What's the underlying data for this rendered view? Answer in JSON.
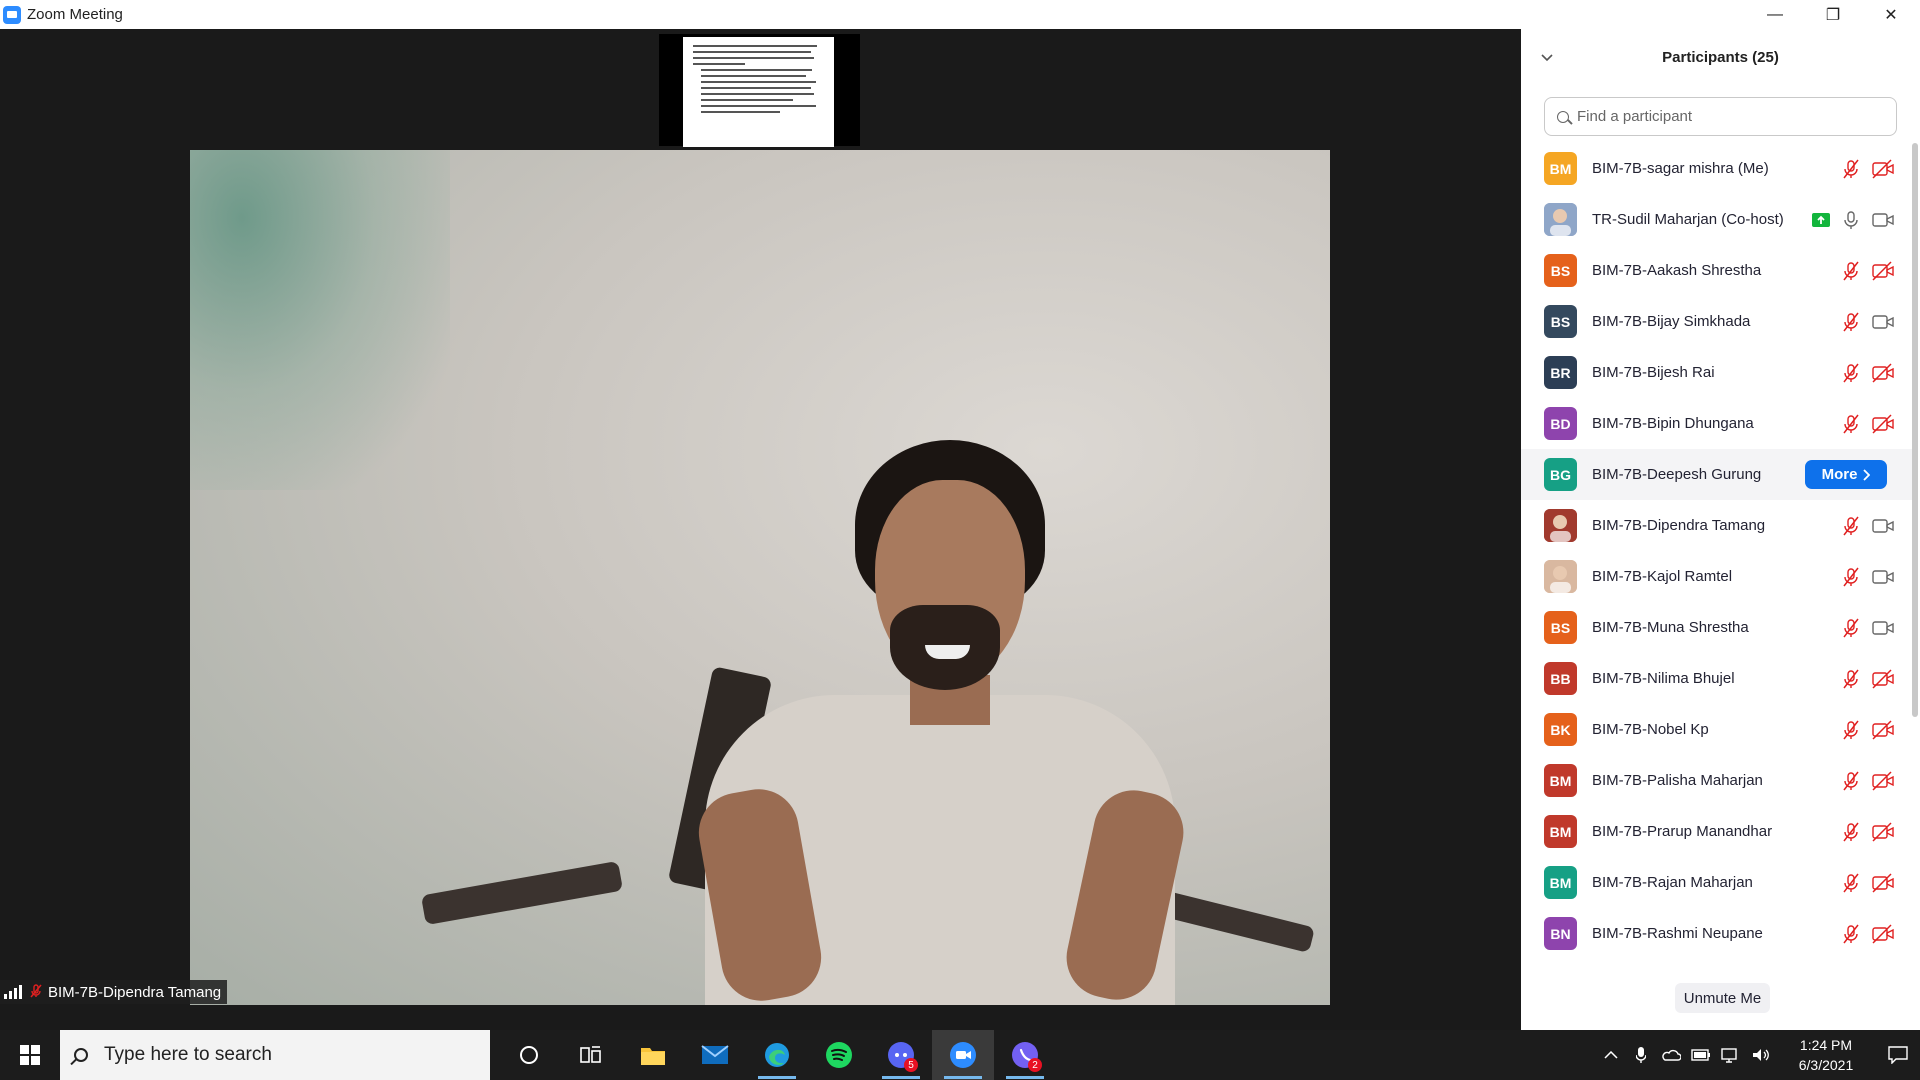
{
  "window": {
    "title": "Zoom Meeting",
    "controls": {
      "minimize": "—",
      "restore": "❐",
      "close": "✕"
    }
  },
  "meeting": {
    "speaker_name": "BIM-7B-Dipendra Tamang"
  },
  "participants_panel": {
    "title": "Participants (25)",
    "search_placeholder": "Find a participant",
    "more_label": "More",
    "unmute_label": "Unmute Me",
    "participants": [
      {
        "initials": "BM",
        "color": "#f5a623",
        "name": "BIM-7B-sagar mishra (Me)",
        "mic": "off",
        "video": "off"
      },
      {
        "initials": "",
        "color": "#8fa6c8",
        "name": "TR-Sudil Maharjan (Co-host)",
        "mic": "on",
        "video": "on",
        "sharing": true,
        "photo": true
      },
      {
        "initials": "BS",
        "color": "#e5611b",
        "name": "BIM-7B-Aakash Shrestha",
        "mic": "off",
        "video": "off"
      },
      {
        "initials": "BS",
        "color": "#34495e",
        "name": "BIM-7B-Bijay Simkhada",
        "mic": "off",
        "video": "on"
      },
      {
        "initials": "BR",
        "color": "#2c3e55",
        "name": "BIM-7B-Bijesh Rai",
        "mic": "off",
        "video": "off"
      },
      {
        "initials": "BD",
        "color": "#8e44ad",
        "name": "BIM-7B-Bipin Dhungana",
        "mic": "off",
        "video": "off"
      },
      {
        "initials": "BG",
        "color": "#16a085",
        "name": "BIM-7B-Deepesh Gurung",
        "hover": true
      },
      {
        "initials": "",
        "color": "#a13a2e",
        "name": "BIM-7B-Dipendra Tamang",
        "mic": "off",
        "video": "on",
        "photo": true
      },
      {
        "initials": "",
        "color": "#d9b8a0",
        "name": "BIM-7B-Kajol Ramtel",
        "mic": "off",
        "video": "on",
        "photo": true
      },
      {
        "initials": "BS",
        "color": "#e5611b",
        "name": "BIM-7B-Muna Shrestha",
        "mic": "off",
        "video": "on"
      },
      {
        "initials": "BB",
        "color": "#c0392b",
        "name": "BIM-7B-Nilima Bhujel",
        "mic": "off",
        "video": "off"
      },
      {
        "initials": "BK",
        "color": "#e5611b",
        "name": "BIM-7B-Nobel Kp",
        "mic": "off",
        "video": "off"
      },
      {
        "initials": "BM",
        "color": "#c0392b",
        "name": "BIM-7B-Palisha Maharjan",
        "mic": "off",
        "video": "off"
      },
      {
        "initials": "BM",
        "color": "#c0392b",
        "name": "BIM-7B-Prarup Manandhar",
        "mic": "off",
        "video": "off"
      },
      {
        "initials": "BM",
        "color": "#16a085",
        "name": "BIM-7B-Rajan Maharjan",
        "mic": "off",
        "video": "off"
      },
      {
        "initials": "BN",
        "color": "#8e44ad",
        "name": "BIM-7B-Rashmi Neupane",
        "mic": "off",
        "video": "off"
      }
    ]
  },
  "taskbar": {
    "search_placeholder": "Type here to search",
    "apps": [
      "cortana-icon",
      "task-view-icon",
      "file-explorer-icon",
      "mail-icon",
      "edge-icon",
      "spotify-icon",
      "discord-icon",
      "zoom-icon",
      "viber-icon"
    ],
    "discord_badge": "5",
    "viber_badge": "2",
    "time": "1:24 PM",
    "date": "6/3/2021"
  },
  "colors": {
    "accent": "#0e71eb",
    "muted": "#e02020"
  }
}
